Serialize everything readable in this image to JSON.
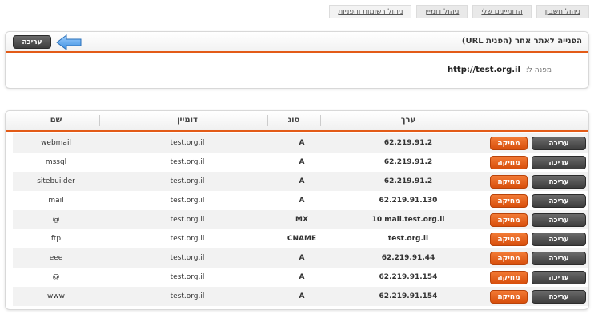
{
  "tabs": [
    {
      "label": "ניהול חשבון"
    },
    {
      "label": "הדומיינים שלי"
    },
    {
      "label": "ניהול דומיין"
    },
    {
      "label": "ניהול רשומות והפניות"
    }
  ],
  "redirect": {
    "title": "הפנייה לאתר אחר (הפנית URL)",
    "edit_label": "עריכה",
    "pointing_label": "מפנה ל:",
    "url": "http://test.org.il"
  },
  "table": {
    "headers": {
      "name": "שם",
      "domain": "דומיין",
      "type": "סוג",
      "value": "ערך"
    },
    "delete_label": "מחיקה",
    "edit_label": "עריכה",
    "rows": [
      {
        "name": "webmail",
        "domain": "test.org.il",
        "type": "A",
        "value": "62.219.91.2"
      },
      {
        "name": "mssql",
        "domain": "test.org.il",
        "type": "A",
        "value": "62.219.91.2"
      },
      {
        "name": "sitebuilder",
        "domain": "test.org.il",
        "type": "A",
        "value": "62.219.91.2"
      },
      {
        "name": "mail",
        "domain": "test.org.il",
        "type": "A",
        "value": "62.219.91.130"
      },
      {
        "name": "@",
        "domain": "test.org.il",
        "type": "MX",
        "value": "10 mail.test.org.il"
      },
      {
        "name": "ftp",
        "domain": "test.org.il",
        "type": "CNAME",
        "value": "test.org.il"
      },
      {
        "name": "eee",
        "domain": "test.org.il",
        "type": "A",
        "value": "62.219.91.44"
      },
      {
        "name": "@",
        "domain": "test.org.il",
        "type": "A",
        "value": "62.219.91.154"
      },
      {
        "name": "www",
        "domain": "test.org.il",
        "type": "A",
        "value": "62.219.91.154"
      }
    ]
  },
  "colors": {
    "accent": "#e35b17",
    "delete_button": "#e0601a",
    "edit_button": "#4a4a4a",
    "arrow": "#5aa3e6"
  },
  "icons": {
    "arrow": "left-arrow-icon"
  }
}
